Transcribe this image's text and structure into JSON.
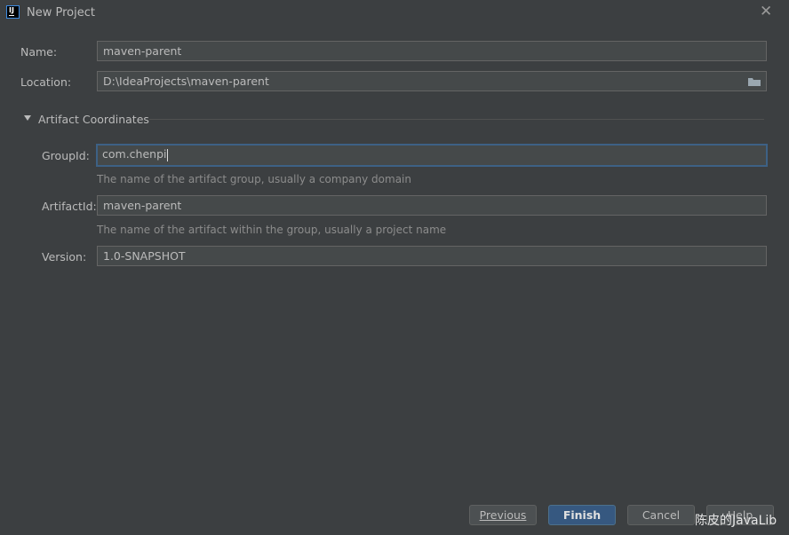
{
  "window": {
    "title": "New Project",
    "icon": "intellij-idea-icon",
    "close_icon": "close-icon"
  },
  "name": {
    "label": "Name:",
    "value": "maven-parent"
  },
  "location": {
    "label": "Location:",
    "value": "D:\\IdeaProjects\\maven-parent",
    "browse_icon": "folder-icon"
  },
  "artifact": {
    "section_label": "Artifact Coordinates",
    "expanded": true,
    "group_id": {
      "label": "GroupId:",
      "value": "com.chenpi",
      "hint": "The name of the artifact group, usually a company domain"
    },
    "artifact_id": {
      "label": "ArtifactId:",
      "value": "maven-parent",
      "hint": "The name of the artifact within the group, usually a project name"
    },
    "version": {
      "label": "Version:",
      "value": "1.0-SNAPSHOT"
    }
  },
  "buttons": {
    "previous": "Previous",
    "finish": "Finish",
    "cancel": "Cancel",
    "help": "Help"
  },
  "watermark": "陈皮的JavaLib",
  "colors": {
    "background": "#3c3f41",
    "default_button": "#365880",
    "focus_border": "#3d6185"
  }
}
